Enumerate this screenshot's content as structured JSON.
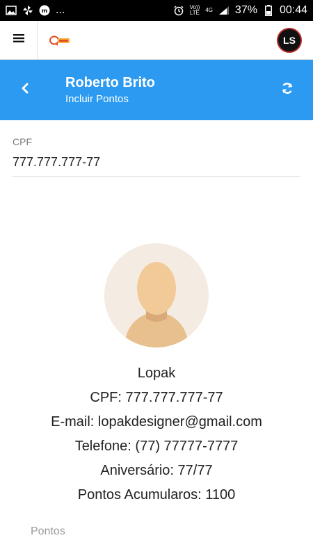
{
  "statusbar": {
    "battery": "37%",
    "time": "00:44",
    "network": "4G",
    "volte_top": "Vo))",
    "volte_bottom": "LTE",
    "ellipsis": "..."
  },
  "topbar": {
    "avatar_initials": "LS"
  },
  "header": {
    "title": "Roberto Brito",
    "subtitle": "Incluir Pontos"
  },
  "form": {
    "cpf_label": "CPF",
    "cpf_value": "777.777.777-77"
  },
  "profile": {
    "name": "Lopak",
    "cpf": "CPF: 777.777.777-77",
    "email": "E-mail: lopakdesigner@gmail.com",
    "phone": "Telefone: (77) 77777-7777",
    "birthday": "Aniversário: 77/77",
    "points": "Pontos Acumularos: 1100"
  },
  "points_field": {
    "label": "Pontos"
  },
  "colors": {
    "header_bg": "#2c9af0",
    "statusbar_bg": "#000000"
  },
  "icons": [
    "image-icon",
    "pinwheel-icon",
    "mm-app-icon",
    "alarm-icon",
    "signal-icon",
    "battery-icon",
    "menu-icon",
    "back-icon",
    "refresh-icon"
  ]
}
